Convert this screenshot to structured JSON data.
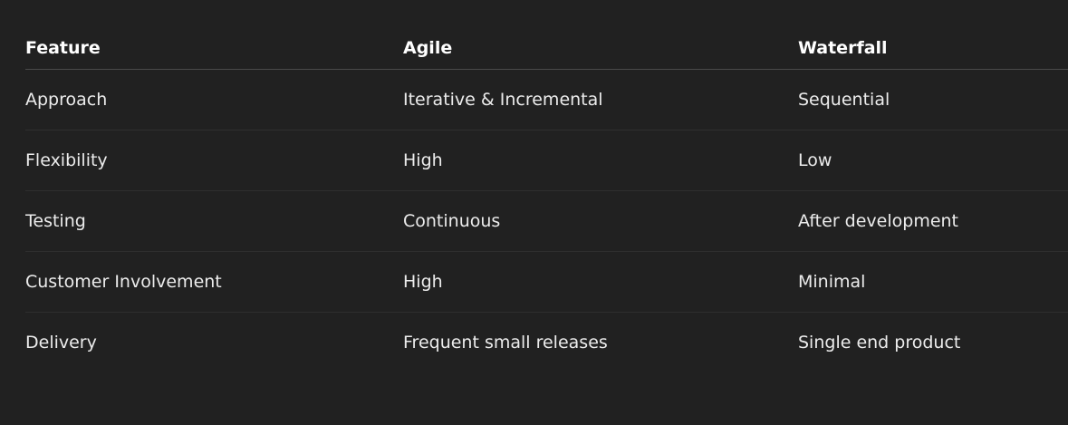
{
  "table": {
    "headers": [
      "Feature",
      "Agile",
      "Waterfall"
    ],
    "rows": [
      [
        "Approach",
        "Iterative & Incremental",
        "Sequential"
      ],
      [
        "Flexibility",
        "High",
        "Low"
      ],
      [
        "Testing",
        "Continuous",
        "After development"
      ],
      [
        "Customer Involvement",
        "High",
        "Minimal"
      ],
      [
        "Delivery",
        "Frequent small releases",
        "Single end product"
      ]
    ]
  }
}
